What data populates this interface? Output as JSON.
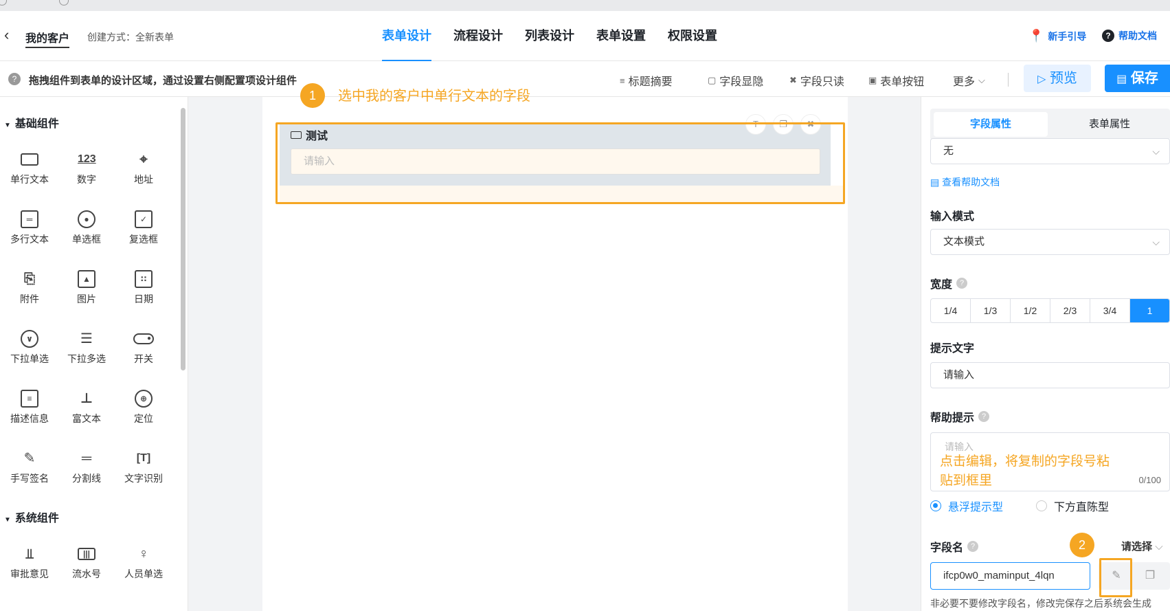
{
  "header": {
    "app_title": "我的客户",
    "create_mode": "创建方式：全新表单",
    "tabs": [
      {
        "label": "表单设计",
        "active": true
      },
      {
        "label": "流程设计"
      },
      {
        "label": "列表设计"
      },
      {
        "label": "表单设置"
      },
      {
        "label": "权限设置"
      }
    ],
    "guide_label": "新手引导",
    "help_doc_label": "帮助文档"
  },
  "toolbar": {
    "tip": "拖拽组件到表单的设计区域，通过设置右侧配置项设计组件",
    "title_summary": "标题摘要",
    "field_visibility": "字段显隐",
    "field_readonly": "字段只读",
    "form_buttons": "表单按钮",
    "more": "更多",
    "preview": "预览",
    "save": "保存"
  },
  "left_panel": {
    "basic_title": "基础组件",
    "basic_components": [
      {
        "label": "单行文本",
        "icon": "single-line-text-icon"
      },
      {
        "label": "数字",
        "icon": "number-icon",
        "glyph": "123"
      },
      {
        "label": "地址",
        "icon": "location-pin-icon"
      },
      {
        "label": "多行文本",
        "icon": "multi-line-text-icon"
      },
      {
        "label": "单选框",
        "icon": "radio-icon"
      },
      {
        "label": "复选框",
        "icon": "checkbox-icon"
      },
      {
        "label": "附件",
        "icon": "paperclip-icon"
      },
      {
        "label": "图片",
        "icon": "image-icon"
      },
      {
        "label": "日期",
        "icon": "calendar-icon"
      },
      {
        "label": "下拉单选",
        "icon": "dropdown-single-icon"
      },
      {
        "label": "下拉多选",
        "icon": "dropdown-multi-icon"
      },
      {
        "label": "开关",
        "icon": "toggle-icon"
      },
      {
        "label": "描述信息",
        "icon": "description-icon"
      },
      {
        "label": "富文本",
        "icon": "rich-text-icon"
      },
      {
        "label": "定位",
        "icon": "crosshair-icon"
      },
      {
        "label": "手写签名",
        "icon": "signature-icon"
      },
      {
        "label": "分割线",
        "icon": "divider-icon"
      },
      {
        "label": "文字识别",
        "icon": "text-recognition-icon"
      }
    ],
    "system_title": "系统组件",
    "system_components": [
      {
        "label": "审批意见",
        "icon": "stamp-icon"
      },
      {
        "label": "流水号",
        "icon": "serial-number-icon"
      },
      {
        "label": "人员单选",
        "icon": "person-icon"
      }
    ]
  },
  "canvas": {
    "field_label": "测试",
    "field_placeholder": "请输入",
    "callout1_num": "1",
    "callout1_text": "选中我的客户中单行文本的字段"
  },
  "right_panel": {
    "tab_field_props": "字段属性",
    "tab_form_props": "表单属性",
    "top_select_value": "无",
    "help_link": "查看帮助文档",
    "input_mode_label": "输入模式",
    "input_mode_value": "文本模式",
    "width_label": "宽度",
    "width_options": [
      "1/4",
      "1/3",
      "1/2",
      "2/3",
      "3/4",
      "1"
    ],
    "width_selected": "1",
    "placeholder_label": "提示文字",
    "placeholder_value": "请输入",
    "help_hint_label": "帮助提示",
    "help_hint_placeholder": "请输入",
    "help_hint_count": "0/100",
    "callout2_text": "点击编辑，将复制的字段号粘贴到框里",
    "radio_float": "悬浮提示型",
    "radio_below": "下方直陈型",
    "field_name_label": "字段名",
    "field_name_select": "请选择",
    "field_name_value": "ifcp0w0_maminput_4lqn",
    "callout2_num": "2",
    "field_name_note": "非必要不要修改字段名，修改完保存之后系统会生成"
  },
  "colors": {
    "accent": "#1890ff",
    "callout": "#f5a623"
  }
}
